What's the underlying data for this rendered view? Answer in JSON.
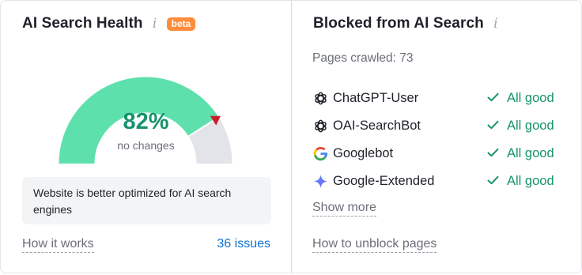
{
  "health": {
    "title": "AI Search Health",
    "info_icon": "info-icon",
    "badge": "beta",
    "score_text": "82%",
    "score_value": 82,
    "change_text": "no changes",
    "note": "Website is better optimized for AI search engines",
    "how_it_works": "How it works",
    "issues": "36 issues",
    "colors": {
      "good": "#5ee0ad",
      "rest": "#e3e4ea",
      "marker": "#cf1b2a",
      "score": "#16936d"
    }
  },
  "blocked": {
    "title": "Blocked from AI Search",
    "info_icon": "info-icon",
    "pages_crawled": "Pages crawled: 73",
    "bots": [
      {
        "name": "ChatGPT-User",
        "icon": "openai-icon",
        "status": "All good"
      },
      {
        "name": "OAI-SearchBot",
        "icon": "openai-icon",
        "status": "All good"
      },
      {
        "name": "Googlebot",
        "icon": "google-icon",
        "status": "All good"
      },
      {
        "name": "Google-Extended",
        "icon": "gemini-sparkle-icon",
        "status": "All good"
      }
    ],
    "show_more": "Show more",
    "unblock": "How to unblock pages"
  }
}
